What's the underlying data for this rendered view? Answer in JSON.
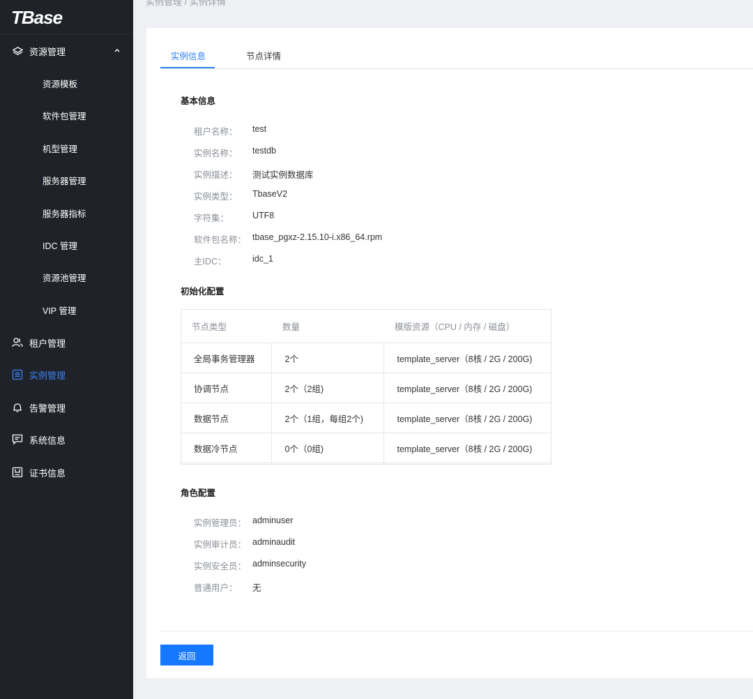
{
  "breadcrumb": "实例管理 / 实例详情",
  "sidebar": {
    "logo": "TBase",
    "group_resource": {
      "label": "资源管理",
      "icon": "layers-icon"
    },
    "resource_items": [
      {
        "label": "资源模板"
      },
      {
        "label": "软件包管理"
      },
      {
        "label": "机型管理"
      },
      {
        "label": "服务器管理"
      },
      {
        "label": "服务器指标"
      },
      {
        "label": "IDC 管理"
      },
      {
        "label": "资源池管理"
      },
      {
        "label": "VIP 管理"
      }
    ],
    "groups": [
      {
        "label": "租户管理",
        "icon": "users-icon"
      },
      {
        "label": "实例管理",
        "icon": "list-icon",
        "active": true
      },
      {
        "label": "告警管理",
        "icon": "bell-icon"
      },
      {
        "label": "系统信息",
        "icon": "message-icon"
      },
      {
        "label": "证书信息",
        "icon": "certificate-icon"
      }
    ]
  },
  "tabs": [
    {
      "label": "实例信息",
      "active": true
    },
    {
      "label": "节点详情",
      "active": false
    }
  ],
  "basic": {
    "title": "基本信息",
    "rows": [
      {
        "k": "租户名称：",
        "v": "test"
      },
      {
        "k": "实例名称：",
        "v": "testdb"
      },
      {
        "k": "实例描述：",
        "v": "测试实例数据库"
      },
      {
        "k": "实例类型：",
        "v": "TbaseV2"
      },
      {
        "k": "字符集：",
        "v": "UTF8"
      },
      {
        "k": "软件包名称：",
        "v": "tbase_pgxz-2.15.10-i.x86_64.rpm"
      },
      {
        "k": "主IDC：",
        "v": "idc_1"
      }
    ]
  },
  "init": {
    "title": "初始化配置",
    "headers": [
      "节点类型",
      "数量",
      "模版资源（CPU / 内存 / 磁盘）"
    ],
    "rows": [
      [
        "全局事务管理器",
        "2个",
        "template_server（8核 / 2G / 200G)"
      ],
      [
        "协调节点",
        "2个（2组)",
        "template_server（8核 / 2G / 200G)"
      ],
      [
        "数据节点",
        "2个（1组，每组2个)",
        "template_server（8核 / 2G / 200G)"
      ],
      [
        "数据冷节点",
        "0个（0组)",
        "template_server（8核 / 2G / 200G)"
      ]
    ]
  },
  "roles": {
    "title": "角色配置",
    "rows": [
      {
        "k": "实例管理员：",
        "v": "adminuser"
      },
      {
        "k": "实例审计员：",
        "v": "adminaudit"
      },
      {
        "k": "实例安全员：",
        "v": "adminsecurity"
      },
      {
        "k": "普通用户：",
        "v": "无"
      }
    ]
  },
  "footer": {
    "back_label": "返回"
  },
  "colors": {
    "sidebar_bg": "#1f2228",
    "accent": "#1677ff",
    "active_nav": "#3b82f6"
  }
}
